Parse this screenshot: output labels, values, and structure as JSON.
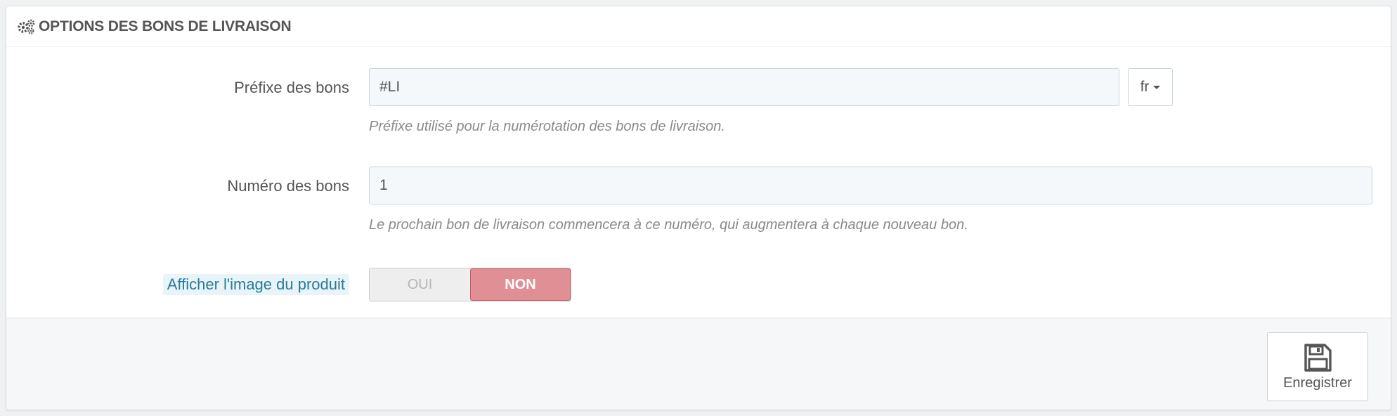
{
  "panel": {
    "title": "OPTIONS DES BONS DE LIVRAISON",
    "icon": "gears-icon"
  },
  "fields": {
    "prefix": {
      "label": "Préfixe des bons",
      "value": "#LI",
      "language": "fr",
      "help": "Préfixe utilisé pour la numérotation des bons de livraison."
    },
    "number": {
      "label": "Numéro des bons",
      "value": "1",
      "help": "Le prochain bon de livraison commencera à ce numéro, qui augmentera à chaque nouveau bon."
    },
    "product_image": {
      "label": "Afficher l'image du produit",
      "yes_label": "OUI",
      "no_label": "NON",
      "selected": "NON"
    }
  },
  "footer": {
    "save_label": "Enregistrer",
    "save_icon": "floppy-disk-icon"
  },
  "colors": {
    "no_active": "#e08f95",
    "tooltip_label": "#2a7b9b",
    "input_bg": "#f4f8fa"
  }
}
